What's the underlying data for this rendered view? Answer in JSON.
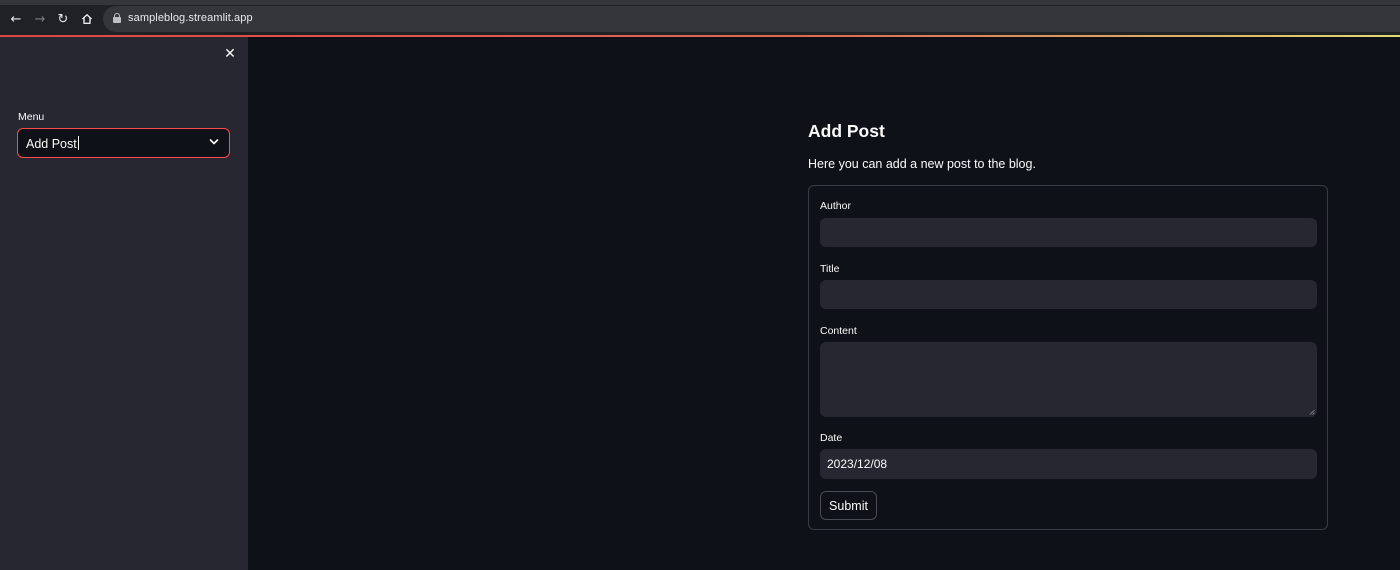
{
  "browser": {
    "url": "sampleblog.streamlit.app",
    "icons": [
      "back-arrow-icon",
      "forward-arrow-icon",
      "reload-icon",
      "home-icon",
      "lock-icon"
    ]
  },
  "sidebar": {
    "menu_label": "Menu",
    "menu_selected": "Add Post",
    "icons": [
      "close-icon",
      "chevron-down-icon"
    ]
  },
  "main": {
    "title": "Add Post",
    "subtitle": "Here you can add a new post to the blog.",
    "form": {
      "author_label": "Author",
      "author_value": "",
      "title_label": "Title",
      "title_value": "",
      "content_label": "Content",
      "content_value": "",
      "date_label": "Date",
      "date_value": "2023/12/08",
      "submit_label": "Submit"
    }
  },
  "colors": {
    "app_background": "#0e1117",
    "sidebar_background": "#262730",
    "input_background": "#262730",
    "accent": "#ff4b4b",
    "text": "#fafafa"
  }
}
